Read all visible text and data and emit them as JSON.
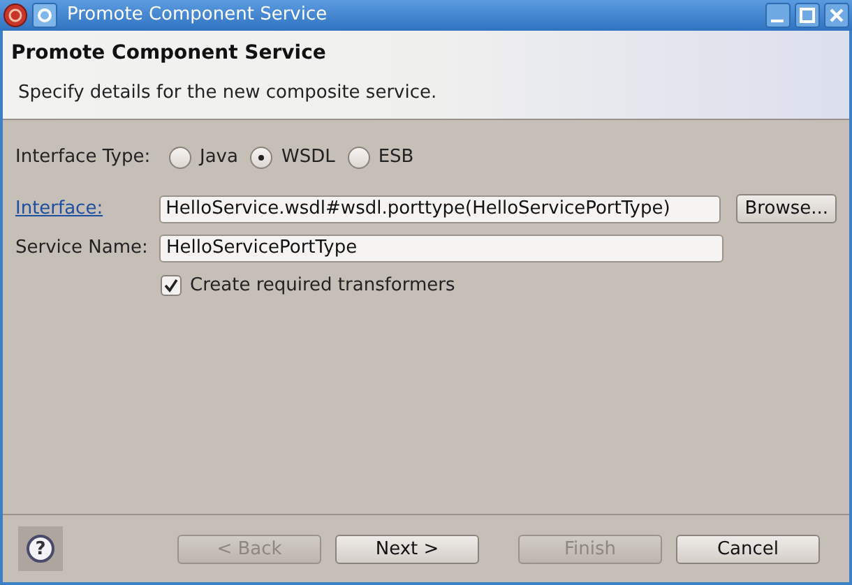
{
  "window": {
    "title": "Promote Component Service"
  },
  "header": {
    "title": "Promote Component Service",
    "description": "Specify details for the new composite service."
  },
  "interface_type": {
    "label": "Interface Type:",
    "options": [
      {
        "label": "Java",
        "selected": false
      },
      {
        "label": "WSDL",
        "selected": true
      },
      {
        "label": "ESB",
        "selected": false
      }
    ]
  },
  "interface": {
    "label": "Interface:",
    "value": "HelloService.wsdl#wsdl.porttype(HelloServicePortType)",
    "browse": "Browse..."
  },
  "service_name": {
    "label": "Service Name:",
    "value": "HelloServicePortType"
  },
  "create_transformers": {
    "label": "Create required transformers",
    "checked": true
  },
  "help": "?",
  "buttons": [
    {
      "label": "< Back",
      "disabled": true
    },
    {
      "label": "Next >",
      "disabled": false
    },
    {
      "label": "Finish",
      "disabled": true
    },
    {
      "label": "Cancel",
      "disabled": false
    }
  ]
}
